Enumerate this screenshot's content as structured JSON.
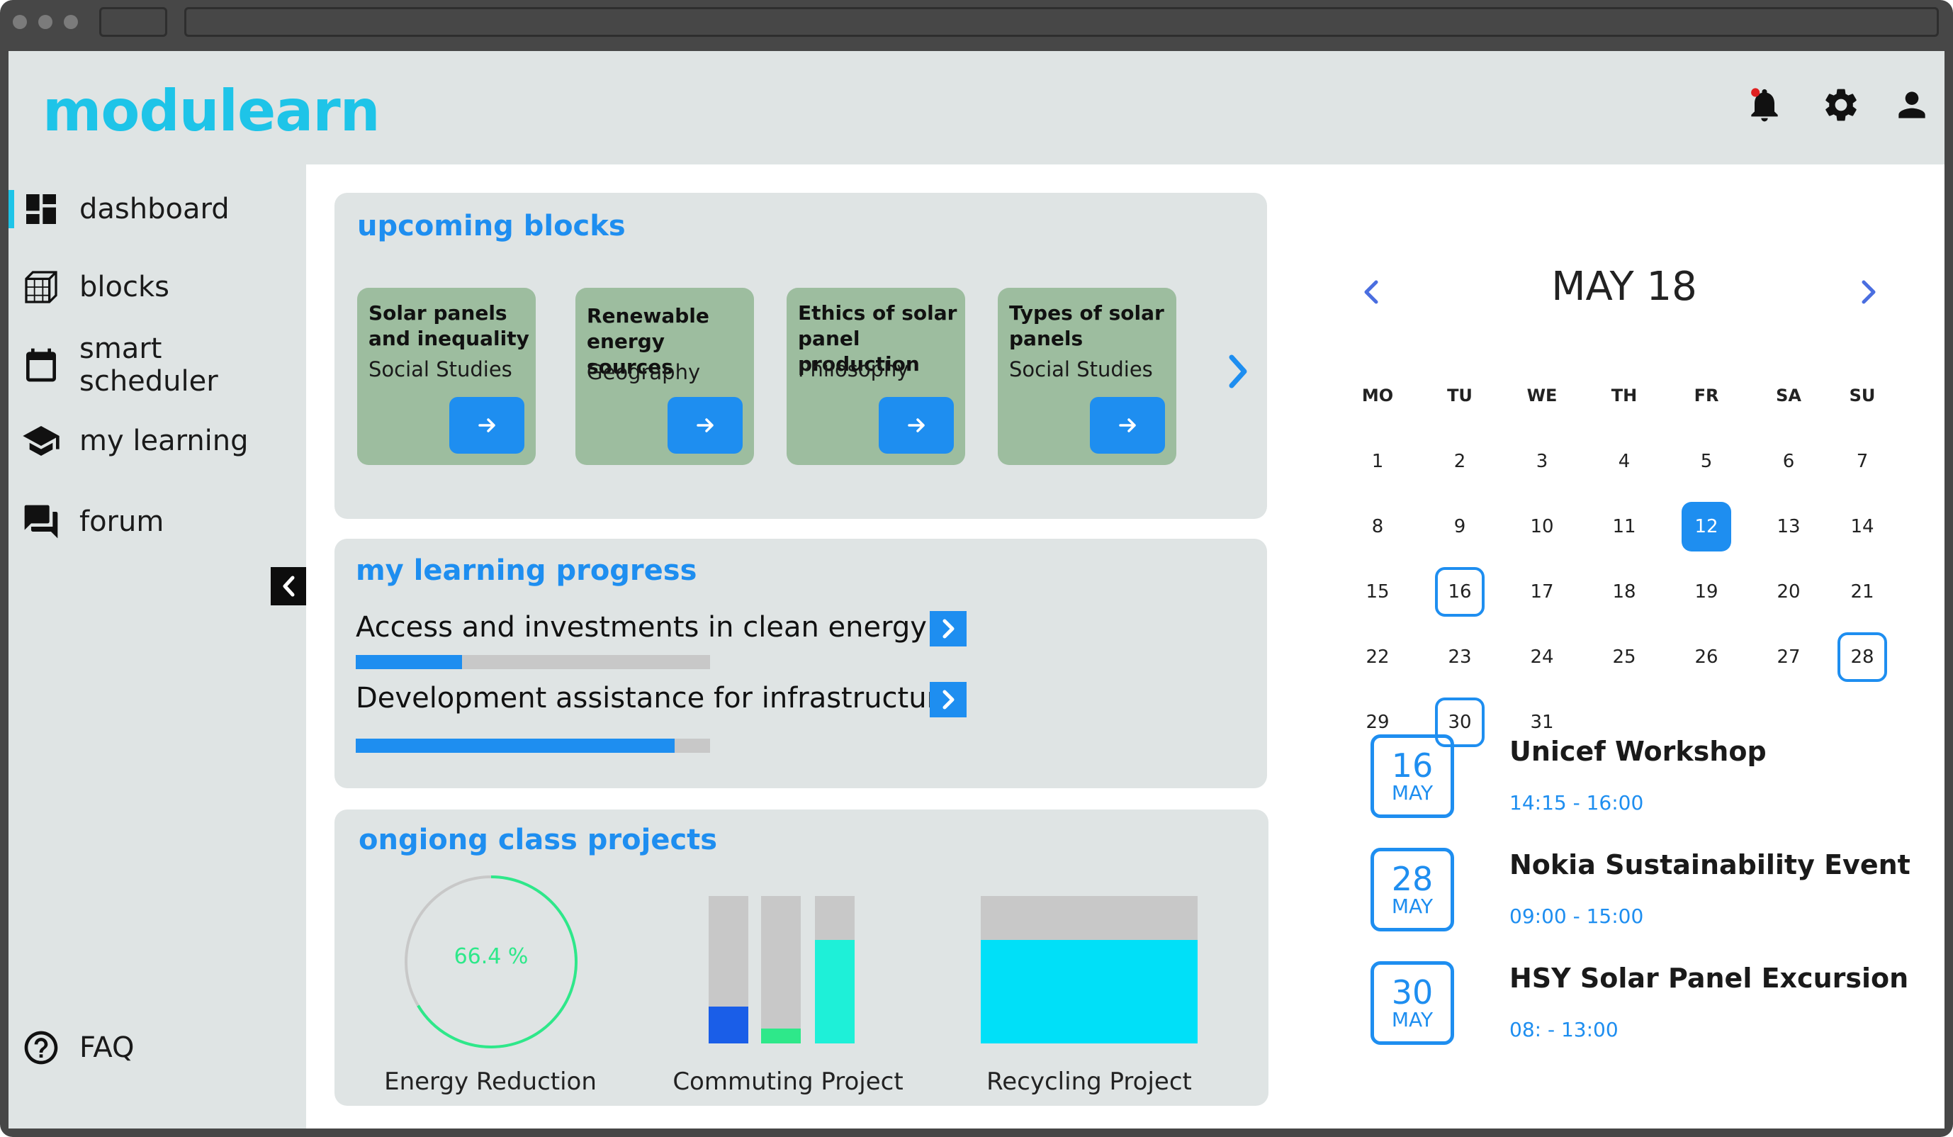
{
  "app": {
    "logo": "modulearn",
    "colors": {
      "brand": "#1ec4e8",
      "accent": "#1e8ef0",
      "block_bg": "#9dbd9f",
      "card_bg": "#dfe4e4",
      "notification_dot": "#e02020"
    }
  },
  "header": {
    "icons": [
      "notification-bell-icon",
      "gear-icon",
      "user-icon"
    ]
  },
  "sidebar": {
    "items": [
      {
        "label": "dashboard",
        "icon": "dashboard-icon",
        "active": true
      },
      {
        "label": "blocks",
        "icon": "cube-icon"
      },
      {
        "label": "smart scheduler",
        "icon": "calendar-icon"
      },
      {
        "label": "my learning",
        "icon": "graduation-cap-icon"
      },
      {
        "label": "forum",
        "icon": "forum-icon"
      }
    ],
    "footer": {
      "label": "FAQ",
      "icon": "help-circle-icon"
    }
  },
  "upcoming": {
    "title": "upcoming blocks",
    "blocks": [
      {
        "title": "Solar panels and inequality",
        "subject": "Social Studies"
      },
      {
        "title": "Renewable energy sources",
        "subject": "Geography"
      },
      {
        "title": "Ethics of solar panel production",
        "subject": "Philosophy"
      },
      {
        "title": "Types of solar panels",
        "subject": "Social Studies"
      }
    ]
  },
  "progress": {
    "title": "my learning progress",
    "items": [
      {
        "label": "Access and investments in clean energy",
        "fraction": 0.3
      },
      {
        "label": "Development assistance for infrastructure",
        "fraction": 0.9
      }
    ]
  },
  "projects": {
    "title": "ongiong class projects",
    "energy": {
      "label": "Energy Reduction",
      "value_text": "66.4 %",
      "fraction": 0.664,
      "color": "#2ee88a"
    },
    "commuting": {
      "label": "Commuting Project",
      "bars": [
        {
          "fraction": 0.25,
          "color": "#1a5ee8"
        },
        {
          "fraction": 0.1,
          "color": "#2ee88a"
        },
        {
          "fraction": 0.7,
          "color": "#1ef0d8"
        }
      ]
    },
    "recycling": {
      "label": "Recycling Project",
      "fraction": 0.7,
      "color": "#00e0f8"
    }
  },
  "calendar": {
    "month_label": "MAY 18",
    "weekdays": [
      "MO",
      "TU",
      "WE",
      "TH",
      "FR",
      "SA",
      "SU"
    ],
    "weeks": [
      [
        "1",
        "2",
        "3",
        "4",
        "5",
        "6",
        "7"
      ],
      [
        "8",
        "9",
        "10",
        "11",
        "12",
        "13",
        "14"
      ],
      [
        "15",
        "16",
        "17",
        "18",
        "19",
        "20",
        "21"
      ],
      [
        "22",
        "23",
        "24",
        "25",
        "26",
        "27",
        "28"
      ],
      [
        "29",
        "30",
        "31"
      ]
    ],
    "selected_day": "12",
    "event_days": [
      "16",
      "28",
      "30"
    ]
  },
  "events": [
    {
      "day": "16",
      "month": "MAY",
      "title": "Unicef Workshop",
      "time": "14:15 - 16:00"
    },
    {
      "day": "28",
      "month": "MAY",
      "title": "Nokia Sustainability Event",
      "time": "09:00 - 15:00"
    },
    {
      "day": "30",
      "month": "MAY",
      "title": "HSY Solar Panel Excursion",
      "time": "08: - 13:00"
    }
  ]
}
